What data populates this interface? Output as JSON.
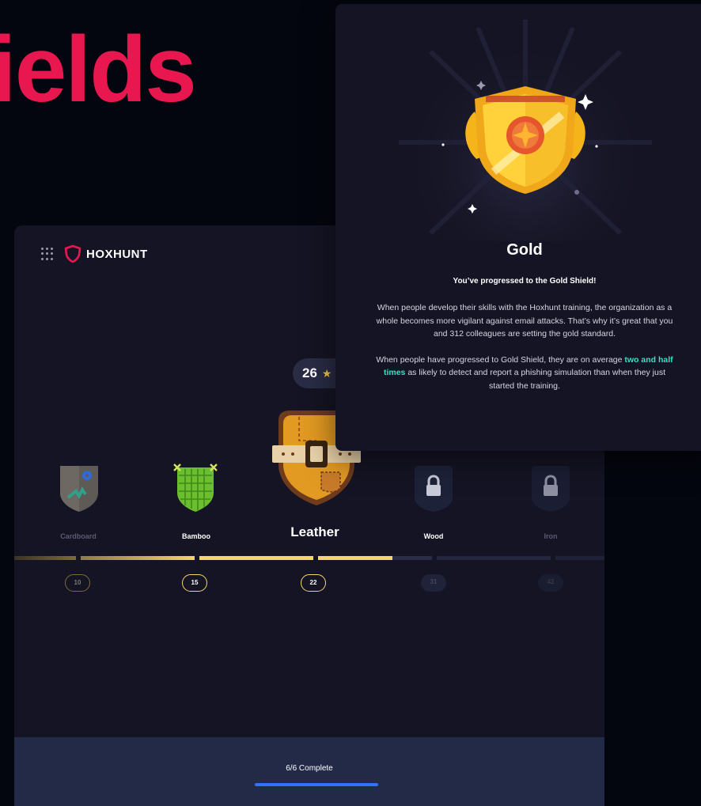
{
  "headline": "ields",
  "app": {
    "brand": "HOXHUNT",
    "stars_count": "26",
    "tiers": [
      {
        "name": "Cardboard",
        "milestone": "10",
        "state": "dim"
      },
      {
        "name": "Bamboo",
        "milestone": "15",
        "state": "unlocked"
      },
      {
        "name": "Leather",
        "milestone": "22",
        "state": "current"
      },
      {
        "name": "Wood",
        "milestone": "31",
        "state": "locked"
      },
      {
        "name": "Iron",
        "milestone": "42",
        "state": "locked"
      }
    ],
    "footer": {
      "status": "6/6 Complete",
      "progress": 1.0
    }
  },
  "modal": {
    "title": "Gold",
    "subtitle": "You’ve progressed to the Gold Shield!",
    "para1": "When people develop their skills with the Hoxhunt training, the organization as a whole becomes more vigilant against email attacks. That’s why it’s great that you and 312 colleagues are setting the gold standard.",
    "para2_pre": "When people have progressed to Gold Shield, they are on average ",
    "para2_highlight": "two and half times",
    "para2_post": " as likely to detect and report a phishing simulation than when they just started the training."
  },
  "colors": {
    "brand_red": "#e8174f",
    "gold": "#f5c842",
    "accent_teal": "#2fe5c3",
    "footer_bar": "#2f73ff"
  }
}
